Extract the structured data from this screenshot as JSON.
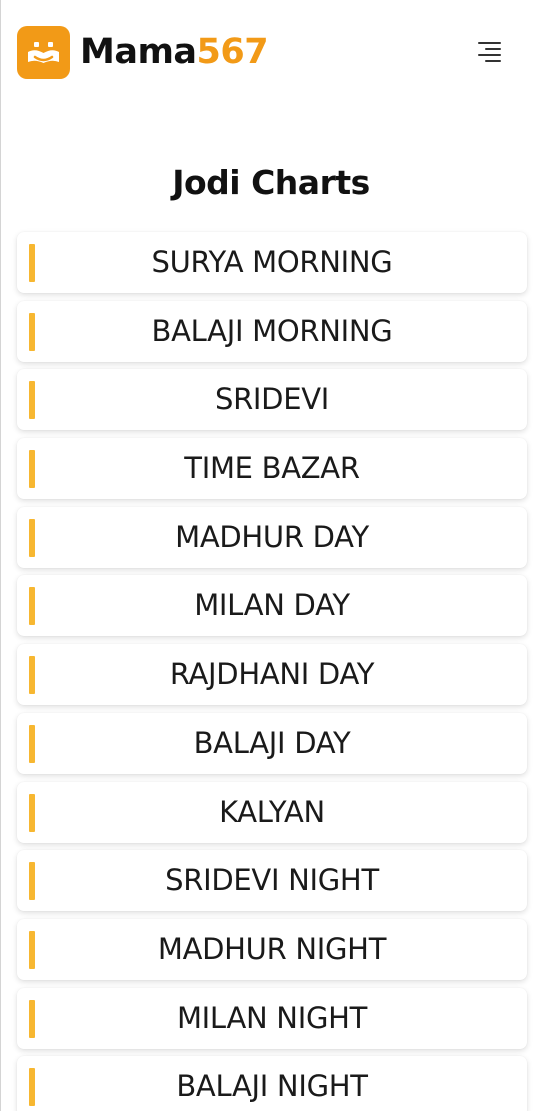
{
  "header": {
    "brand_part1": "Mama",
    "brand_part2": "567",
    "logo_icon": "smiling-book-icon",
    "menu_icon": "hamburger-menu-icon",
    "brand_color": "#f29a17"
  },
  "page": {
    "title": "Jodi Charts"
  },
  "charts": {
    "items": [
      {
        "label": "SURYA MORNING"
      },
      {
        "label": "BALAJI MORNING"
      },
      {
        "label": "SRIDEVI"
      },
      {
        "label": "TIME BAZAR"
      },
      {
        "label": "MADHUR DAY"
      },
      {
        "label": "MILAN DAY"
      },
      {
        "label": "RAJDHANI DAY"
      },
      {
        "label": "BALAJI DAY"
      },
      {
        "label": "KALYAN"
      },
      {
        "label": "SRIDEVI NIGHT"
      },
      {
        "label": "MADHUR NIGHT"
      },
      {
        "label": "MILAN NIGHT"
      },
      {
        "label": "BALAJI NIGHT"
      }
    ],
    "accent_color": "#f7b731"
  }
}
